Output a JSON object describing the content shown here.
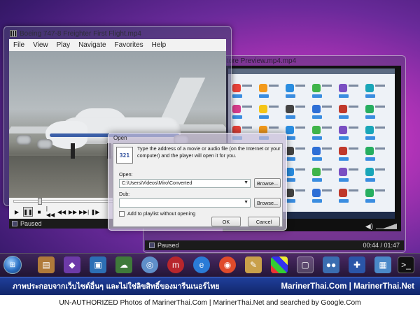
{
  "window1": {
    "title": "Boeing 747-8 Freighter First Flight.mp4",
    "menu": [
      "File",
      "View",
      "Play",
      "Navigate",
      "Favorites",
      "Help"
    ],
    "status": "Paused",
    "seek_progress": 0.13
  },
  "window2": {
    "title": "Store Preview.mp4.mp4",
    "status": "Paused",
    "time": "00:44 / 01:47"
  },
  "dialog": {
    "title": "Open",
    "icon_text": "321",
    "description": "Type the address of a movie or audio file (on the Internet or your computer) and the player will open it for you.",
    "open_label": "Open:",
    "open_value": "C:\\Users\\Videos\\Miro\\Converted",
    "dub_label": "Dub:",
    "dub_value": "",
    "browse_label": "Browse...",
    "checkbox_label": "Add to playlist without opening",
    "ok_label": "OK",
    "cancel_label": "Cancel"
  },
  "taskbar": {
    "icons": [
      "start-icon",
      "briefcase-icon",
      "media-center-icon",
      "save-icon",
      "network-icon",
      "chrome-icon",
      "miro-icon",
      "internet-explorer-icon",
      "chrome-icon",
      "paint-icon",
      "tiles-icon",
      "media-player-classic-icon",
      "group-icon",
      "puzzle-icon",
      "photo-icon",
      "command-prompt-icon"
    ]
  },
  "banner": {
    "thai": "ภาพประกอบจากเว็บไซต์อื่นๆ และไม่ใช่ลิขสิทธิ์ของมารีนเนอร์ไทย",
    "site": "MarinerThai.Com | MarinerThai.Net"
  },
  "footer": {
    "text": "UN-AUTHORIZED Photos of MarinerThai.Com | MarinerThai.Net and searched by Google.Com"
  },
  "colors": {
    "banner_blue": "#1f3f9a",
    "desktop_magenta": "#b233b8"
  }
}
